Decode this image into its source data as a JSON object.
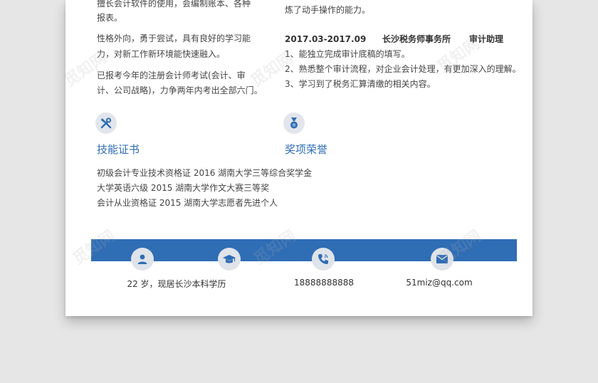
{
  "left_column": {
    "para1": [
      "擅长会计软件的使用，会编制账本、各种",
      "报表。"
    ],
    "para2": [
      "性格外向，勇于尝试，具有良好的学习能",
      "力，对新工作新环境能快速融入。"
    ],
    "para3": [
      "已报考今年的注册会计师考试(会计、审",
      "计、公司战略)，力争两年内考出全部六门。"
    ]
  },
  "right_column": {
    "prev_line": "炼了动手操作的能力。",
    "job": {
      "period": "2017.03-2017.09",
      "company": "长沙税务师事务所",
      "title": "审计助理",
      "duties": [
        "1、能独立完成审计底稿的填写。",
        "2、熟悉整个审计流程，对企业会计处理，有更加深入的理解。",
        "3、学习到了税务汇算清缴的相关内容。"
      ]
    }
  },
  "sections": {
    "skills_title": "技能证书",
    "awards_title": "奖项荣誉",
    "skills_lines": [
      "初级会计专业技术资格证 2016    湖南大学三等综合奖学金",
      "大学英语六级 2015    湖南大学作文大赛三等奖",
      "会计从业资格证 2015    湖南大学志愿者先进个人"
    ]
  },
  "contact": {
    "age_location": "22 岁，现居长沙本科学历",
    "phone": "18888888888",
    "email": "51miz@qq.com"
  },
  "watermark": "觅知网",
  "colors": {
    "accent": "#2f6db5",
    "icon_bg": "#e2e6ec",
    "page_bg": "#e6e6e6"
  },
  "icons": {
    "skills": "tools-icon",
    "awards": "medal-icon",
    "person": "person-icon",
    "education": "graduation-cap-icon",
    "phone": "phone-icon",
    "email": "envelope-icon"
  }
}
